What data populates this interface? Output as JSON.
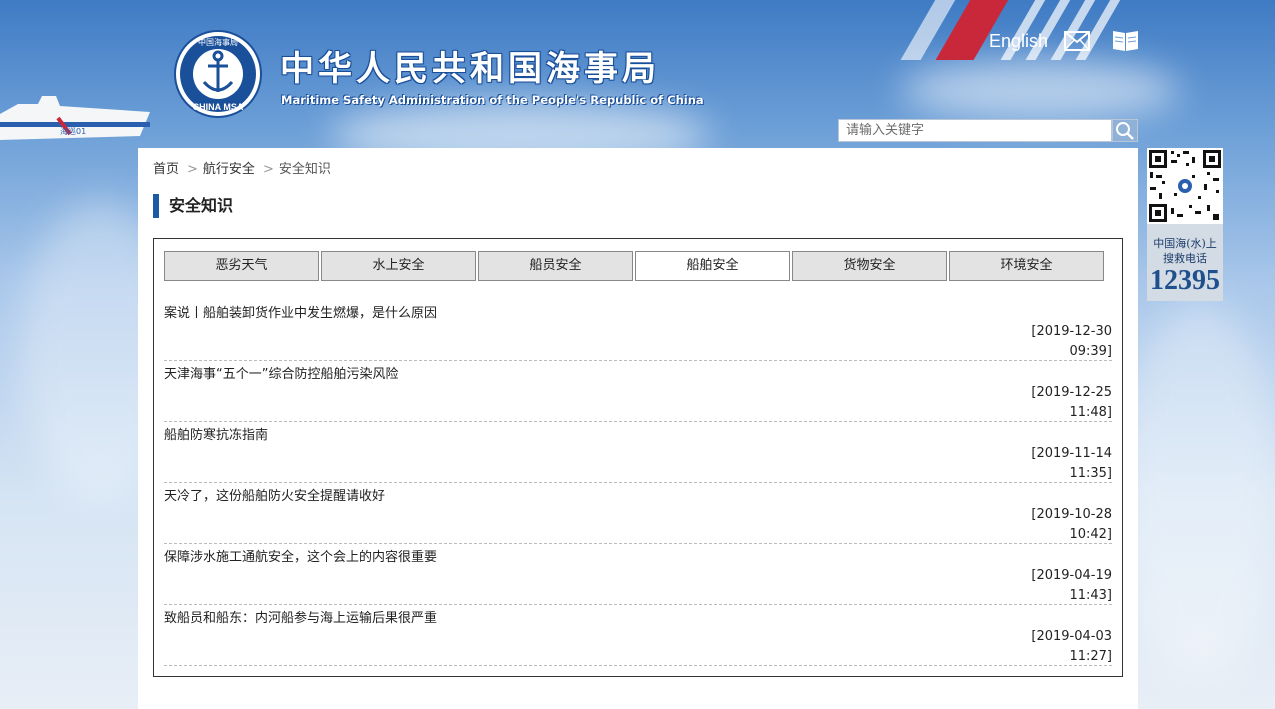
{
  "header": {
    "title_cn": "中华人民共和国海事局",
    "title_en": "Maritime Safety Administration of the People's Republic of China",
    "logo_text_top": "中国海事局",
    "logo_text_bottom": "CHINA MSA",
    "ship_label": "海巡01",
    "lang_link": "English",
    "mail_icon": "mail-icon",
    "book_icon": "book-icon",
    "search_placeholder": "请输入关键字",
    "search_icon": "search-icon"
  },
  "breadcrumb": {
    "items": [
      "首页",
      "航行安全",
      "安全知识"
    ],
    "separator": ">"
  },
  "section_title": "安全知识",
  "tabs": [
    {
      "label": "恶劣天气",
      "active": false
    },
    {
      "label": "水上安全",
      "active": false
    },
    {
      "label": "船员安全",
      "active": false
    },
    {
      "label": "船舶安全",
      "active": true
    },
    {
      "label": "货物安全",
      "active": false
    },
    {
      "label": "环境安全",
      "active": false
    }
  ],
  "news": [
    {
      "title": "案说丨船舶装卸货作业中发生燃爆，是什么原因",
      "date": "[2019-12-30",
      "time": "09:39]"
    },
    {
      "title": "天津海事“五个一”综合防控船舶污染风险",
      "date": "[2019-12-25",
      "time": "11:48]"
    },
    {
      "title": "船舶防寒抗冻指南",
      "date": "[2019-11-14",
      "time": "11:35]"
    },
    {
      "title": "天冷了，这份船舶防火安全提醒请收好",
      "date": "[2019-10-28",
      "time": "10:42]"
    },
    {
      "title": "保障涉水施工通航安全，这个会上的内容很重要",
      "date": "[2019-04-19",
      "time": "11:43]"
    },
    {
      "title": "致船员和船东：内河船参与海上运输后果很严重",
      "date": "[2019-04-03",
      "time": "11:27]"
    }
  ],
  "sidebar": {
    "hotline_label_line1": "中国海(水)上",
    "hotline_label_line2": "搜救电话",
    "hotline_number": "12395"
  },
  "colors": {
    "accent": "#1c5aa6",
    "header_sky": "#3f7bc4",
    "tab_bg": "#e3e3e3",
    "stripe_red": "#c8283a"
  }
}
